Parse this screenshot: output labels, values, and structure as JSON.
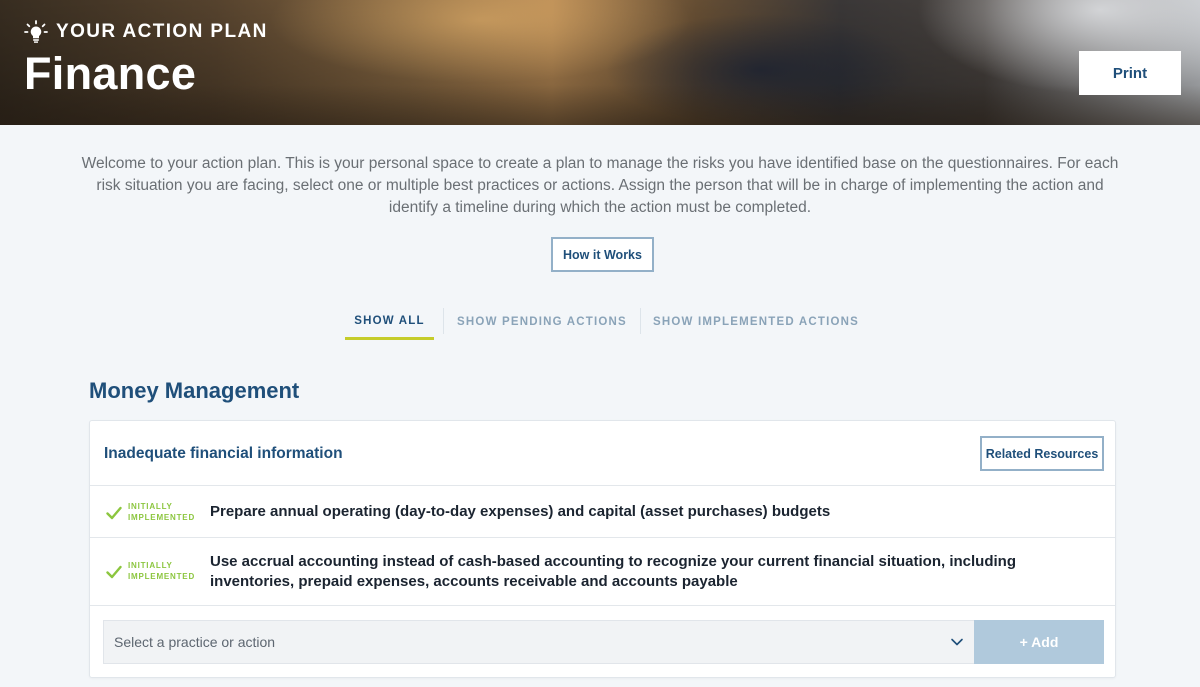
{
  "header": {
    "eyebrow": "YOUR ACTION PLAN",
    "title": "Finance",
    "print_label": "Print"
  },
  "intro": {
    "text": "Welcome to your action plan. This is your personal space to create a plan to manage the risks you have identified base on the questionnaires. For each risk situation you are facing, select one or multiple best practices or actions. Assign the person that will be in charge of implementing the action and identify a timeline during which the action must be completed.",
    "how_label": "How it Works"
  },
  "tabs": [
    {
      "label": "SHOW ALL",
      "active": true
    },
    {
      "label": "SHOW PENDING ACTIONS",
      "active": false
    },
    {
      "label": "SHOW IMPLEMENTED ACTIONS",
      "active": false
    }
  ],
  "section": {
    "title": "Money Management",
    "risk_title": "Inadequate financial information",
    "resources_label": "Related Resources",
    "actions": [
      {
        "status_line1": "INITIALLY",
        "status_line2": "IMPLEMENTED",
        "text": "Prepare annual operating (day-to-day expenses) and capital (asset purchases) budgets"
      },
      {
        "status_line1": "INITIALLY",
        "status_line2": "IMPLEMENTED",
        "text": "Use accrual accounting instead of cash-based accounting to recognize your current financial situation, including inventories, prepaid expenses, accounts receivable and accounts payable"
      }
    ],
    "select_placeholder": "Select a practice or action",
    "add_label": "+ Add"
  },
  "colors": {
    "brand_blue": "#1f4f7a",
    "accent_lime": "#c5cc2a",
    "status_green": "#8cc63f",
    "disabled_blue": "#b0c9dc"
  },
  "icons": [
    "lightbulb-icon",
    "check-icon",
    "chevron-down-icon"
  ]
}
